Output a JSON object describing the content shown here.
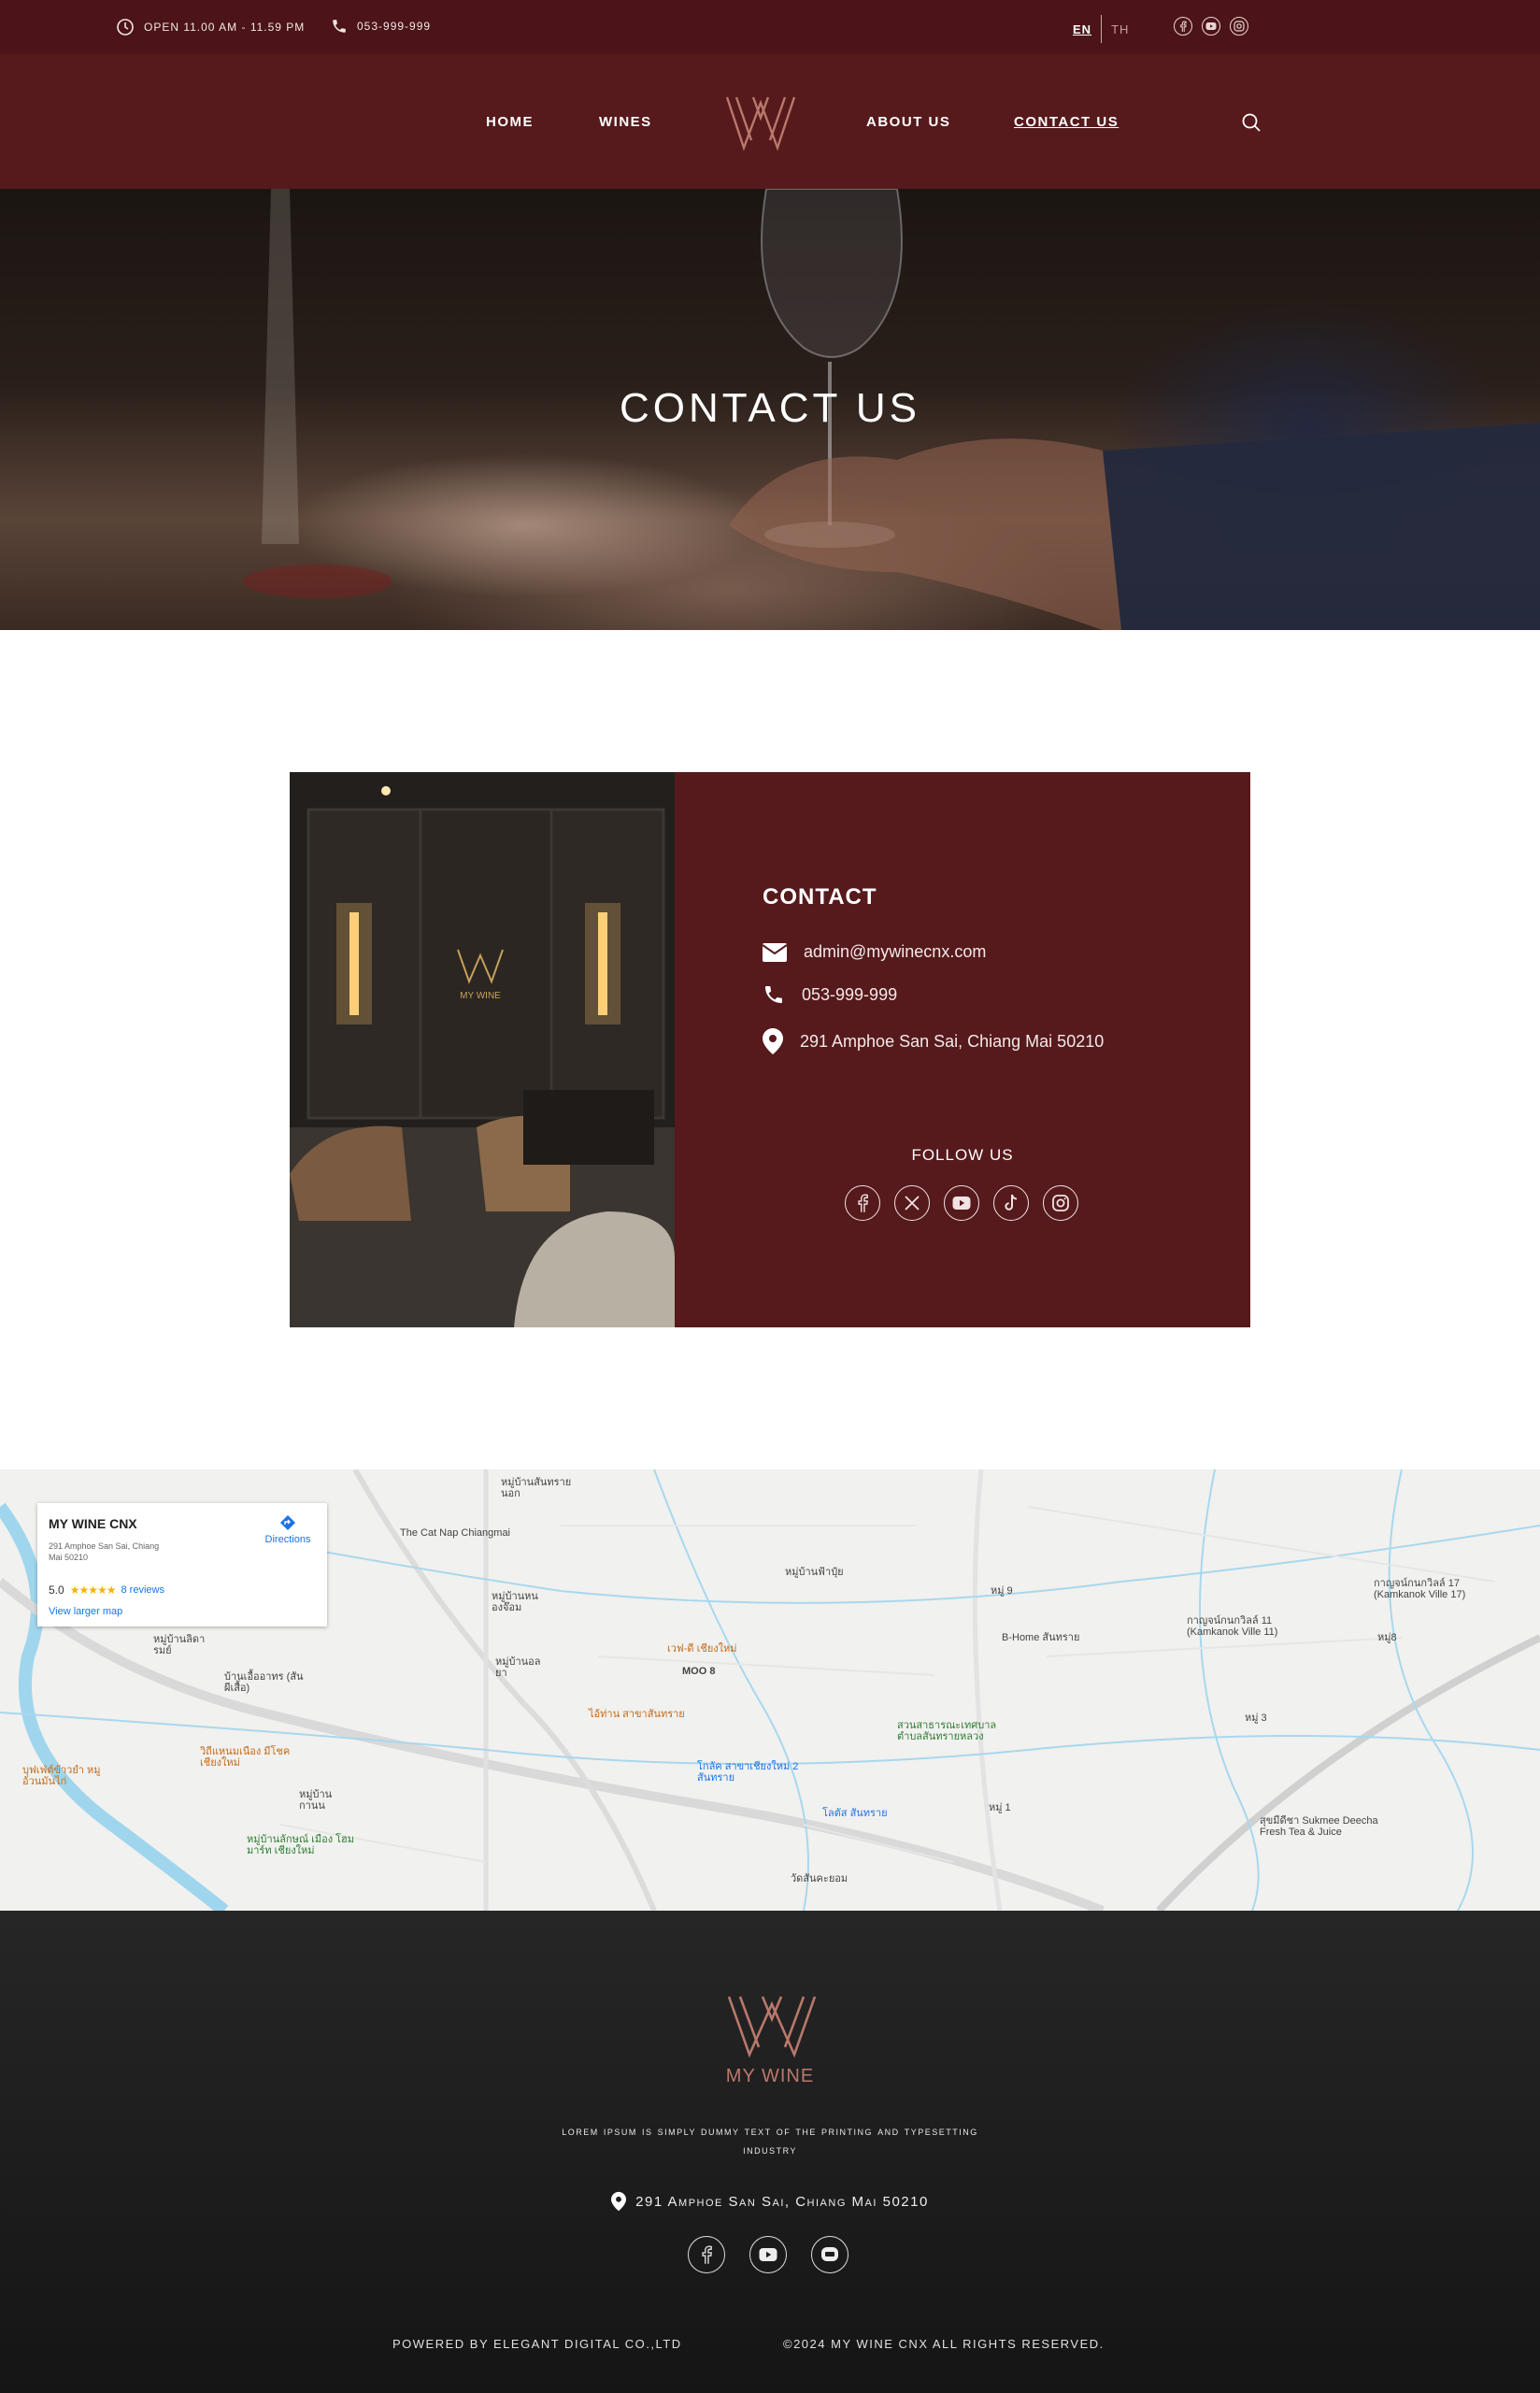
{
  "topbar": {
    "hours": "OPEN 11.00 AM - 11.59 PM",
    "phone": "053-999-999",
    "lang_en": "EN",
    "lang_th": "TH",
    "socials": [
      "facebook-icon",
      "youtube-icon",
      "line-icon"
    ]
  },
  "nav": {
    "home": "HOME",
    "wines": "WINES",
    "about": "ABOUT US",
    "contact": "CONTACT US"
  },
  "hero": {
    "title": "CONTACT US"
  },
  "contact": {
    "heading": "CONTACT",
    "email": "admin@mywinecnx.com",
    "phone": "053-999-999",
    "address": "291 Amphoe San Sai, Chiang Mai 50210",
    "follow": "FOLLOW US",
    "photo_logo": "MY WINE",
    "follow_icons": [
      "facebook-icon",
      "x-icon",
      "youtube-icon",
      "tiktok-icon",
      "instagram-icon"
    ]
  },
  "map": {
    "place": "MY WINE CNX",
    "address": "291 Amphoe San Sai, Chiang Mai 50210",
    "rating": "5.0",
    "stars": "★★★★★",
    "reviews": "8 reviews",
    "larger": "View larger map",
    "directions": "Directions",
    "labels": {
      "catnap": "The Cat Nap Chiangmai",
      "moo8": "MOO 8",
      "bhome": "B-Home สันทราย",
      "kamkanok11": "กาญจน์กนกวิลล์ 11 (Kamkanok Ville 11)",
      "kamkanok17": "กาญจน์กนกวิลล์ 17 (Kamkanok Ville 17)",
      "deecha": "สุขมีดีชา Sukmee Deecha Fresh Tea & Juice",
      "moo9": "หมู่ 9",
      "moo3": "หมู่ 3",
      "moo1": "หมู่ 1",
      "moo8b": "หมู่8",
      "park": "สวนสาธารณะเทศบาล ตำบลสันทรายหลวง",
      "lotus": "โลตัส สันทราย",
      "tesco": "โกลัค สาขาเชียงใหม่ 2 สันทราย",
      "food1": "เวฟ-ดี เชียงใหม่",
      "food2": "ไอ้ท่าน สาขาสันทราย",
      "temple": "วัดสันคะยอม",
      "village1": "หมู่บ้านสันทรายนอก",
      "village2": "หมู่บ้านฟ้าปุ๋ย",
      "village3": "หมู่บ้านลิดารมย์",
      "village4": "บ้านเอื้ออาทร (สันผีเสื้อ)",
      "village5": "วิถีแหนมเนือง มีโชค เชียงใหม่",
      "village6": "บุฟเฟ่ต์ข้าวยำ หมู อ้วนมันไก่",
      "village7": "หมู่บ้านลักษณ์ เมือง โฮมมาร์ท เชียงใหม่",
      "village8": "หมู่บ้านกานน",
      "village9": "หมู่บ้านอลยา",
      "village10": "หมู่บ้านหนองจ๊อม"
    }
  },
  "footer": {
    "brand": "MY WINE",
    "tagline": "Lorem Ipsum is simply dummy text of the printing and typesetting industry",
    "address": "291 Amphoe San Sai, Chiang Mai 50210",
    "powered": "POWERED BY ELEGANT DIGITAL CO.,LTD",
    "copyright": "©2024 MY WINE CNX ALL RIGHTS RESERVED.",
    "socials": [
      "facebook-icon",
      "youtube-icon",
      "line-icon"
    ]
  },
  "colors": {
    "burgundy": "#561a1c",
    "topbar": "#4c1418",
    "footer": "#1e1e1e",
    "brand_copper": "#b9786b"
  }
}
